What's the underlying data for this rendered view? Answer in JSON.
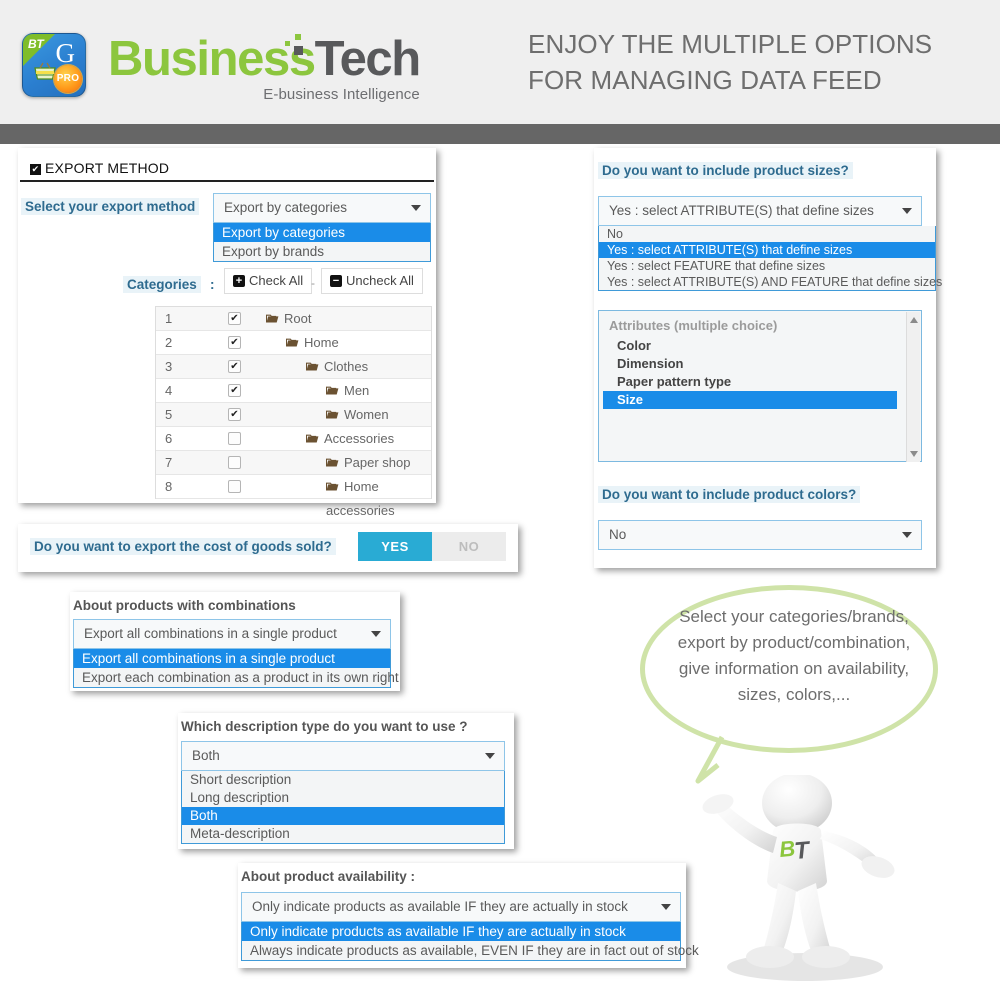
{
  "header": {
    "logo": {
      "word_green": "Business",
      "word_gray": "Tech",
      "tagline": "E-business Intelligence",
      "badge_bt": "BT",
      "badge_g": "G",
      "badge_pro": "PRO"
    },
    "title": "ENJOY THE MULTIPLE OPTIONS FOR MANAGING DATA FEED",
    "band_color": "#666666",
    "bg_color": "#efefef"
  },
  "export_panel": {
    "title": "EXPORT METHOD",
    "checkbox_glyph": "✔",
    "method_label": "Select your export method",
    "colon": ":",
    "method_selected": "Export by categories",
    "method_options": [
      {
        "label": "Export by categories",
        "selected": true
      },
      {
        "label": "Export by brands",
        "selected": false
      }
    ],
    "categories_label": "Categories",
    "check_all": "Check All",
    "uncheck_all": "Uncheck All",
    "separator": "-",
    "plus_glyph": "+",
    "minus_glyph": "−",
    "folder_glyph": "⬛",
    "categories": [
      {
        "num": "1",
        "name": "Root",
        "checked": true,
        "indent": 0
      },
      {
        "num": "2",
        "name": "Home",
        "checked": true,
        "indent": 1
      },
      {
        "num": "3",
        "name": "Clothes",
        "checked": true,
        "indent": 2
      },
      {
        "num": "4",
        "name": "Men",
        "checked": true,
        "indent": 3
      },
      {
        "num": "5",
        "name": "Women",
        "checked": true,
        "indent": 3
      },
      {
        "num": "6",
        "name": "Accessories",
        "checked": false,
        "indent": 2
      },
      {
        "num": "7",
        "name": "Paper shop",
        "checked": false,
        "indent": 3
      },
      {
        "num": "8",
        "name": "Home accessories",
        "checked": false,
        "indent": 3
      }
    ]
  },
  "cogs_panel": {
    "label": "Do you want to export the cost of goods sold?",
    "yes_label": "YES",
    "no_label": "NO",
    "selected": "YES",
    "on_color": "#29abd4",
    "off_color": "#ececec"
  },
  "combinations_panel": {
    "label": "About products with combinations",
    "selected": "Export all combinations in a single product",
    "options": [
      {
        "label": "Export all combinations in a single product",
        "selected": true
      },
      {
        "label": "Export each combination as a product in its own right",
        "selected": false
      }
    ]
  },
  "description_panel": {
    "label": "Which description type do you want to use ?",
    "selected": "Both",
    "options": [
      {
        "label": "Short description",
        "selected": false
      },
      {
        "label": "Long description",
        "selected": false
      },
      {
        "label": "Both",
        "selected": true
      },
      {
        "label": "Meta-description",
        "selected": false
      }
    ]
  },
  "availability_panel": {
    "label": "About product availability :",
    "selected": "Only indicate products as available IF they are actually in stock",
    "options": [
      {
        "label": "Only indicate products as available IF they are actually in stock",
        "selected": true
      },
      {
        "label": "Always indicate products as available, EVEN IF they are in fact out of stock",
        "selected": false
      }
    ]
  },
  "right_panel": {
    "sizes_label": "Do you want to include product sizes?",
    "sizes_selected": "Yes : select ATTRIBUTE(S) that define sizes",
    "sizes_options": [
      {
        "label": "No",
        "selected": false
      },
      {
        "label": "Yes : select ATTRIBUTE(S) that define sizes",
        "selected": true
      },
      {
        "label": "Yes : select FEATURE that define sizes",
        "selected": false
      },
      {
        "label": "Yes : select ATTRIBUTE(S) AND FEATURE that define sizes",
        "selected": false
      }
    ],
    "attributes_header": "Attributes (multiple choice)",
    "attributes": [
      {
        "label": "Color",
        "selected": false
      },
      {
        "label": "Dimension",
        "selected": false
      },
      {
        "label": "Paper pattern type",
        "selected": false
      },
      {
        "label": "Size",
        "selected": true
      }
    ],
    "colors_label": "Do you want to include product colors?",
    "colors_selected": "No"
  },
  "bubble": {
    "text": "Select your categories/brands, export by product/combination, give information on availability, sizes, colors,...",
    "border_color": "#cfe3a8"
  },
  "mascot": {
    "logo_b": "B",
    "logo_t": "T"
  },
  "theme": {
    "accent_blue": "#1a8ce8",
    "label_blue": "#2e6b8f",
    "label_bg": "#e9f3f8",
    "select_border": "#8ec5e8"
  }
}
